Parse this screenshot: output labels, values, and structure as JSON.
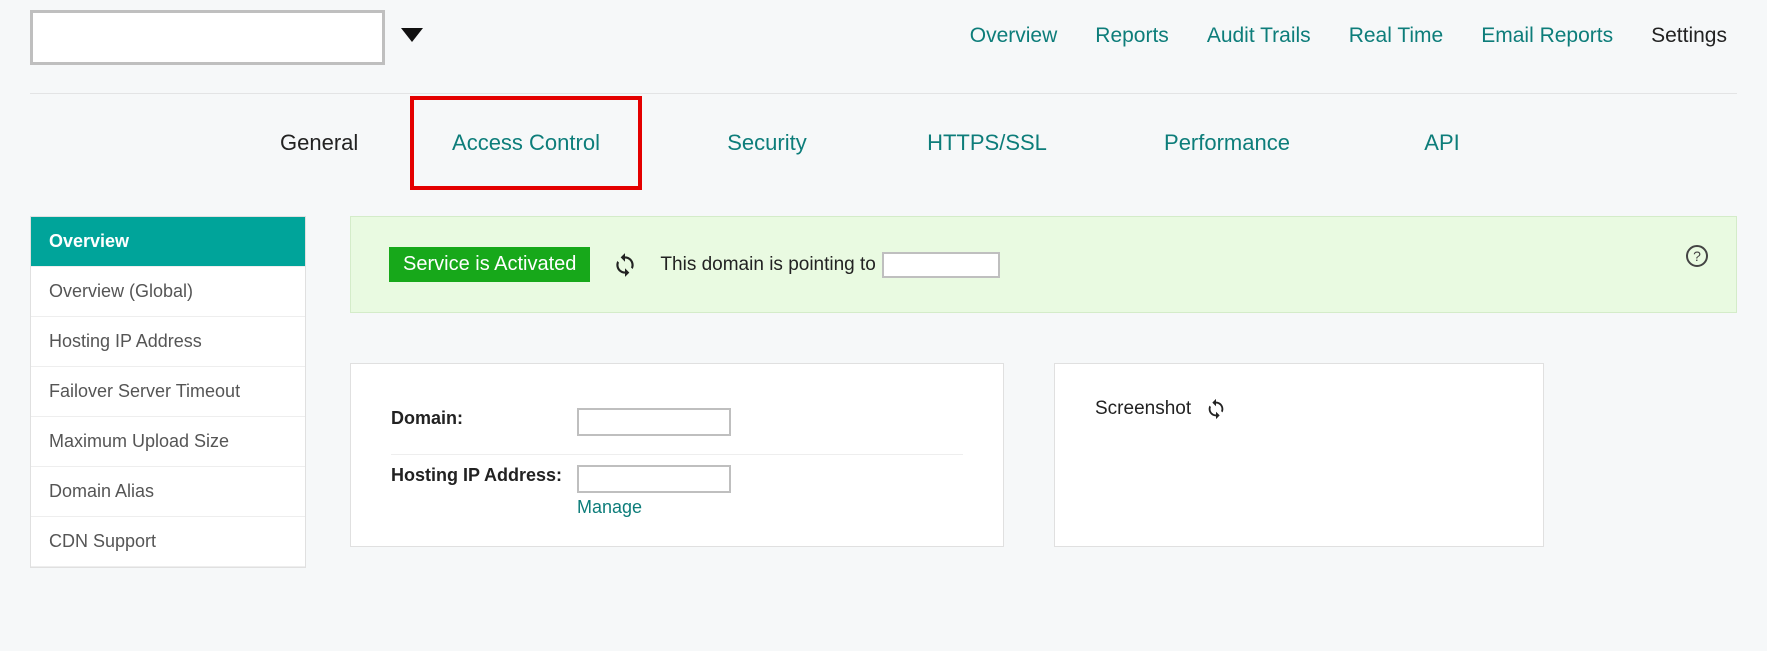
{
  "topnav": {
    "overview": "Overview",
    "reports": "Reports",
    "audit": "Audit Trails",
    "realtime": "Real Time",
    "email": "Email Reports",
    "settings": "Settings"
  },
  "subtabs": {
    "general": "General",
    "access": "Access Control",
    "security": "Security",
    "https": "HTTPS/SSL",
    "performance": "Performance",
    "api": "API"
  },
  "sidebar": {
    "items": [
      "Overview",
      "Overview (Global)",
      "Hosting IP Address",
      "Failover Server Timeout",
      "Maximum Upload Size",
      "Domain Alias",
      "CDN Support"
    ]
  },
  "status": {
    "badge": "Service is Activated",
    "text": "This domain is pointing to"
  },
  "details": {
    "domain_label": "Domain:",
    "hosting_label": "Hosting IP Address:",
    "manage": "Manage"
  },
  "screenshot": {
    "label": "Screenshot"
  }
}
